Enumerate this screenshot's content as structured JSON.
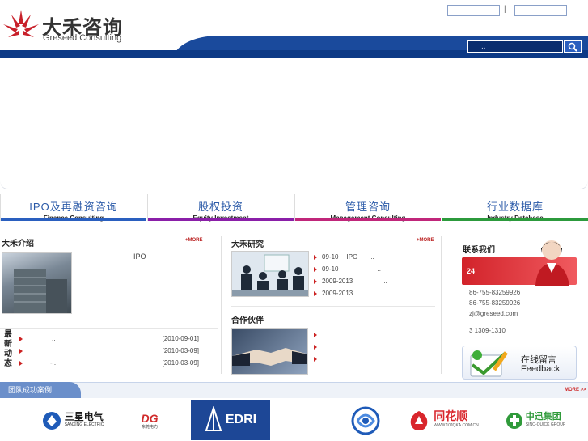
{
  "header": {
    "brand_cn": "大禾咨询",
    "brand_en": "Greseed Consulting",
    "toplinks": [
      "",
      ""
    ],
    "toplink_sep": "|",
    "search_placeholder": ".."
  },
  "nav": [
    {
      "cn": "IPO及再融资咨询",
      "en": "Finance Consulting",
      "color": "#2a5fbf"
    },
    {
      "cn": "股权投资",
      "en": "Equity Investment",
      "color": "#8a1fa8"
    },
    {
      "cn": "管理咨询",
      "en": "Management Consulting",
      "color": "#c0267a"
    },
    {
      "cn": "行业数据库",
      "en": "Industry Database",
      "color": "#2c9a3c"
    }
  ],
  "about": {
    "title": "大禾介绍",
    "more": "+MORE",
    "text": "IPO"
  },
  "news": {
    "label": [
      "最",
      "新",
      "动",
      "态"
    ],
    "items": [
      {
        "title": "..",
        "date": "[2010-09-01]"
      },
      {
        "title": "",
        "date": "[2010-03-09]"
      },
      {
        "title": "- .",
        "date": "[2010-03-09]"
      }
    ]
  },
  "research": {
    "title": "大禾研究",
    "more": "+MORE",
    "items": [
      {
        "date": "09-10",
        "title": "IPO",
        "tail": ".."
      },
      {
        "date": "09-10",
        "title": "",
        "tail": ".."
      },
      {
        "date": "2009-2013",
        "title": "",
        "tail": ".."
      },
      {
        "date": "2009-2013",
        "title": "",
        "tail": ".."
      }
    ]
  },
  "partners": {
    "title": "合作伙伴",
    "items": [
      "",
      "",
      ""
    ]
  },
  "contact": {
    "title": "联系我们",
    "badge": "24",
    "phone1": "86-755-83259926",
    "phone2": "86-755-83259926",
    "email": "zj@greseed.com",
    "mobile": "3 1309-1310",
    "feedback_cn": "在线留言",
    "feedback_en": "Feedback"
  },
  "cases": {
    "title": "团队成功案例",
    "more": "MORE >>",
    "logos": [
      {
        "name": "三星电气",
        "sub": "SANXING ELECTRIC"
      },
      {
        "name": "DG",
        "sub": "东莞电力"
      },
      {
        "name": "EDRI",
        "sub": ""
      },
      {
        "name": "",
        "sub": ""
      },
      {
        "name": "同花顺",
        "sub": "WWW.10JQKA.COM.CN"
      },
      {
        "name": "中迅集团",
        "sub": "SINO-QUICK GROUP"
      }
    ]
  },
  "colors": {
    "brand_red": "#c8202a",
    "brand_blue": "#0d3a86",
    "accent": "#2b5aa8"
  }
}
